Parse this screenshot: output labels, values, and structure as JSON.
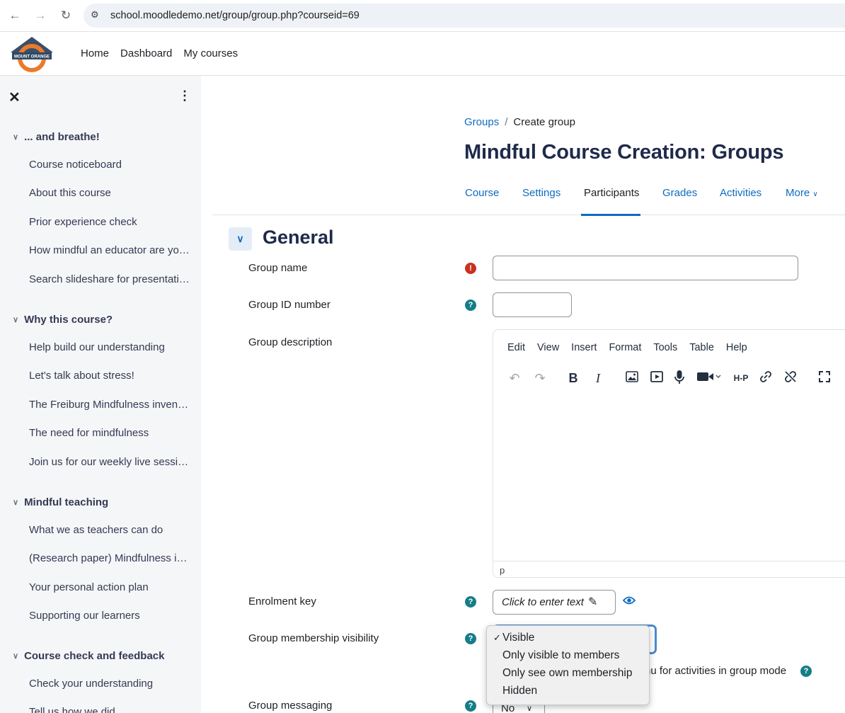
{
  "browser": {
    "url": "school.moodledemo.net/group/group.php?courseid=69",
    "back_icon": "arrow-left-icon",
    "forward_icon": "arrow-right-icon",
    "reload_icon": "reload-icon"
  },
  "header": {
    "logo_text": "MOUNT ORANGE",
    "nav": [
      "Home",
      "Dashboard",
      "My courses"
    ]
  },
  "drawer": {
    "sections": [
      {
        "title": "... and breathe!",
        "items": [
          "Course noticeboard",
          "About this course",
          "Prior experience check",
          "How mindful an educator are you?",
          "Search slideshare for presentations"
        ]
      },
      {
        "title": "Why this course?",
        "items": [
          "Help build our understanding",
          "Let's talk about stress!",
          "The Freiburg Mindfulness inventory",
          "The need for mindfulness",
          "Join us for our weekly live sessions"
        ]
      },
      {
        "title": "Mindful teaching",
        "items": [
          "What we as teachers can do",
          "(Research paper) Mindfulness in education",
          "Your personal action plan",
          "Supporting our learners"
        ]
      },
      {
        "title": "Course check and feedback",
        "items": [
          "Check your understanding",
          "Tell us how we did"
        ]
      }
    ]
  },
  "main": {
    "breadcrumb": {
      "parent": "Groups",
      "sep": "/",
      "current": "Create group"
    },
    "title": "Mindful Course Creation: Groups",
    "tabs": [
      "Course",
      "Settings",
      "Participants",
      "Grades",
      "Activities",
      "More"
    ],
    "active_tab": "Participants",
    "section": "General",
    "fields": {
      "group_name": "Group name",
      "group_id": "Group ID number",
      "group_description": "Group description",
      "enrolment_key": "Enrolment key",
      "membership_visibility": "Group membership visibility",
      "group_messaging": "Group messaging"
    },
    "editor": {
      "menu": [
        "Edit",
        "View",
        "Insert",
        "Format",
        "Tools",
        "Table",
        "Help"
      ],
      "status_path": "p"
    },
    "enrolment_placeholder": "Click to enter text",
    "visibility_options": [
      "Visible",
      "Only visible to members",
      "Only see own membership",
      "Hidden"
    ],
    "visibility_selected": "Visible",
    "behind_text": "nu for activities in group mode",
    "messaging_value": "No"
  },
  "colors": {
    "link": "#0f6cbf",
    "help": "#147e87",
    "required": "#ca3120",
    "title": "#1f2a4a"
  }
}
